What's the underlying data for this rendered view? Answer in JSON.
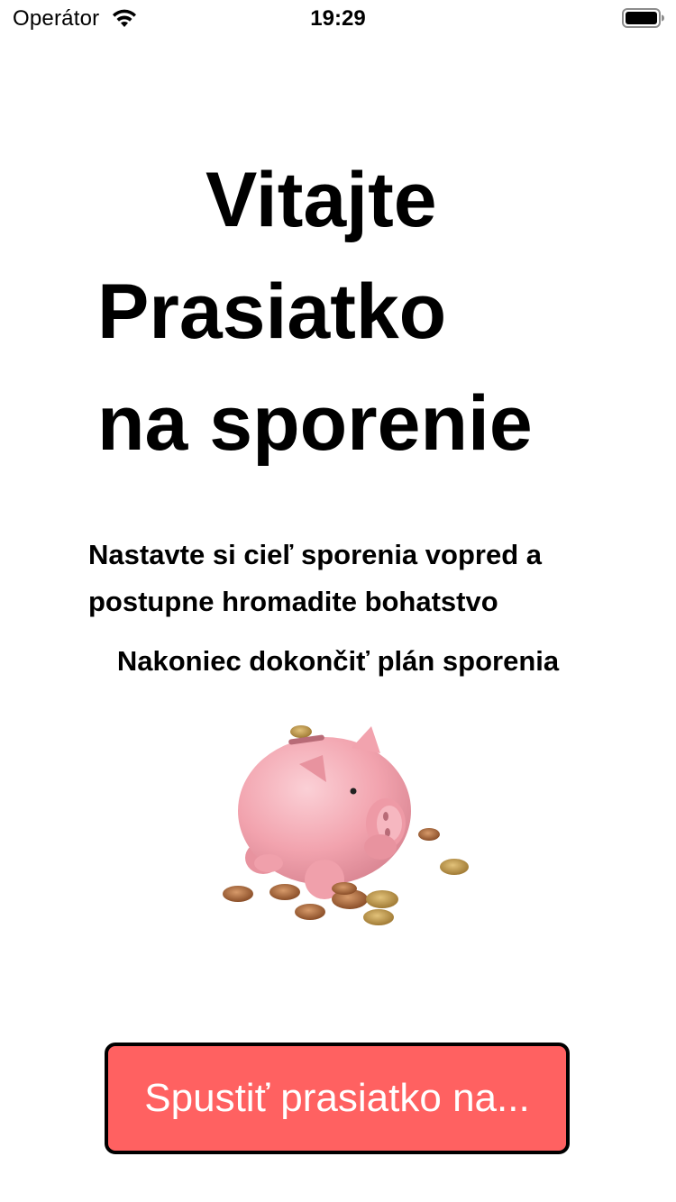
{
  "status_bar": {
    "carrier": "Operátor",
    "time": "19:29",
    "wifi_icon": "wifi-icon",
    "battery_icon": "battery-full-icon"
  },
  "title": {
    "line1": "Vitajte",
    "line2": "Prasiatko",
    "line3": "na sporenie"
  },
  "description": {
    "line1": "Nastavte si cieľ sporenia vopred a",
    "line2": "postupne hromadite bohatstvo"
  },
  "final_text": "Nakoniec dokončiť plán sporenia",
  "illustration": {
    "icon": "piggy-bank-with-coins",
    "pig_color": "#f4a9b4"
  },
  "start_button": {
    "label": "Spustiť prasiatko na...",
    "background": "#ff6161",
    "text_color": "#ffffff"
  }
}
